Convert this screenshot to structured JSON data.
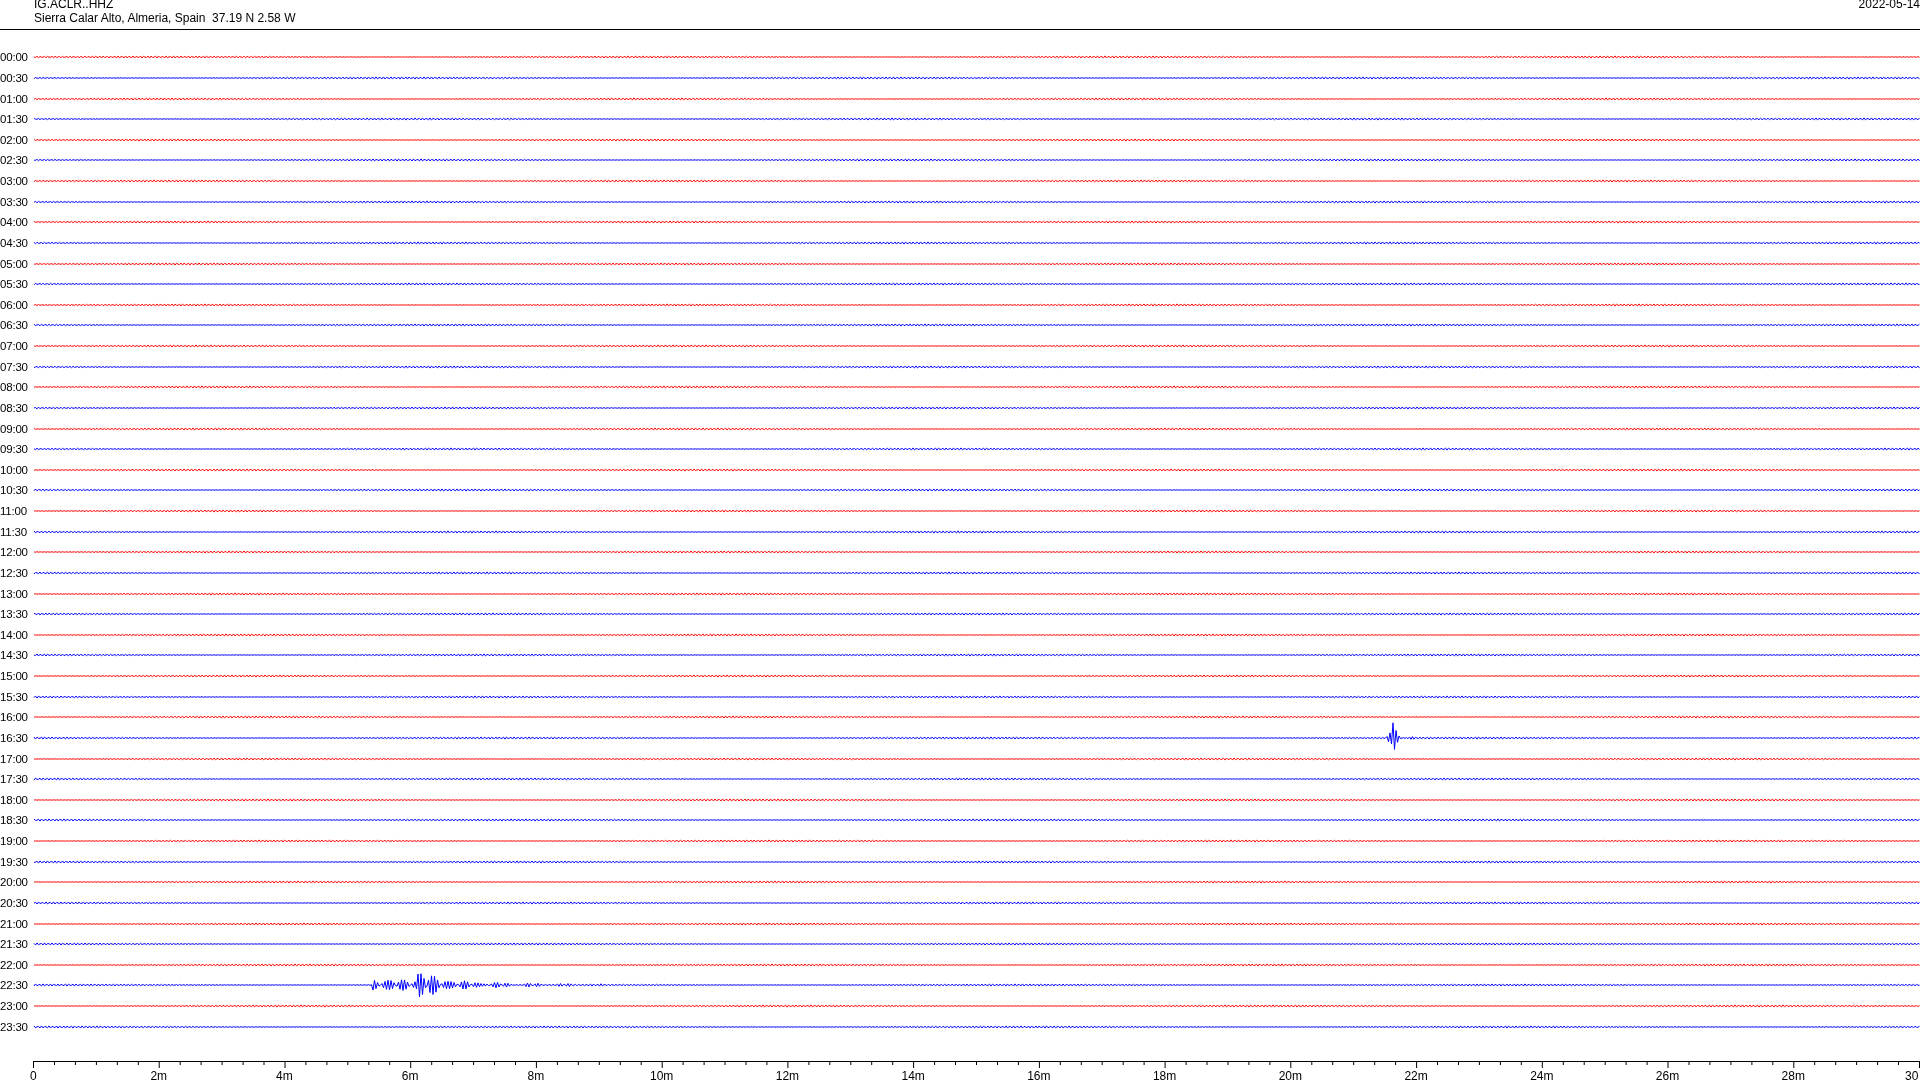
{
  "header": {
    "station": "IG.ACLR..HHZ",
    "location": "Sierra Calar Alto, Almeria, Spain  37.19 N 2.58 W",
    "date": "2022-05-14"
  },
  "rows": [
    {
      "label": "00:00",
      "color": "#ff0000",
      "kind": "quiet"
    },
    {
      "label": "00:30",
      "color": "#0000ff",
      "kind": "quiet"
    },
    {
      "label": "01:00",
      "color": "#ff0000",
      "kind": "quiet"
    },
    {
      "label": "01:30",
      "color": "#0000ff",
      "kind": "quiet"
    },
    {
      "label": "02:00",
      "color": "#ff0000",
      "kind": "quiet"
    },
    {
      "label": "02:30",
      "color": "#0000ff",
      "kind": "quiet"
    },
    {
      "label": "03:00",
      "color": "#ff0000",
      "kind": "quiet"
    },
    {
      "label": "03:30",
      "color": "#0000ff",
      "kind": "quiet"
    },
    {
      "label": "04:00",
      "color": "#ff0000",
      "kind": "quiet"
    },
    {
      "label": "04:30",
      "color": "#0000ff",
      "kind": "quiet"
    },
    {
      "label": "05:00",
      "color": "#ff0000",
      "kind": "quiet"
    },
    {
      "label": "05:30",
      "color": "#0000ff",
      "kind": "quiet"
    },
    {
      "label": "06:00",
      "color": "#ff0000",
      "kind": "quiet"
    },
    {
      "label": "06:30",
      "color": "#0000ff",
      "kind": "quiet"
    },
    {
      "label": "07:00",
      "color": "#ff0000",
      "kind": "quiet"
    },
    {
      "label": "07:30",
      "color": "#0000ff",
      "kind": "quiet"
    },
    {
      "label": "08:00",
      "color": "#ff0000",
      "kind": "quiet"
    },
    {
      "label": "08:30",
      "color": "#0000ff",
      "kind": "quiet"
    },
    {
      "label": "09:00",
      "color": "#ff0000",
      "kind": "quiet"
    },
    {
      "label": "09:30",
      "color": "#0000ff",
      "kind": "quiet"
    },
    {
      "label": "10:00",
      "color": "#ff0000",
      "kind": "quiet"
    },
    {
      "label": "10:30",
      "color": "#0000ff",
      "kind": "quiet"
    },
    {
      "label": "11:00",
      "color": "#ff0000",
      "kind": "quiet"
    },
    {
      "label": "11:30",
      "color": "#0000ff",
      "kind": "quiet"
    },
    {
      "label": "12:00",
      "color": "#ff0000",
      "kind": "quiet"
    },
    {
      "label": "12:30",
      "color": "#0000ff",
      "kind": "quiet"
    },
    {
      "label": "13:00",
      "color": "#ff0000",
      "kind": "quiet"
    },
    {
      "label": "13:30",
      "color": "#0000ff",
      "kind": "quiet"
    },
    {
      "label": "14:00",
      "color": "#ff0000",
      "kind": "quiet"
    },
    {
      "label": "14:30",
      "color": "#0000ff",
      "kind": "quiet"
    },
    {
      "label": "15:00",
      "color": "#ff0000",
      "kind": "quiet"
    },
    {
      "label": "15:30",
      "color": "#0000ff",
      "kind": "quiet"
    },
    {
      "label": "16:00",
      "color": "#ff0000",
      "kind": "quiet"
    },
    {
      "label": "16:30",
      "color": "#0000ff",
      "kind": "spike"
    },
    {
      "label": "17:00",
      "color": "#ff0000",
      "kind": "quiet"
    },
    {
      "label": "17:30",
      "color": "#0000ff",
      "kind": "quiet"
    },
    {
      "label": "18:00",
      "color": "#ff0000",
      "kind": "quiet"
    },
    {
      "label": "18:30",
      "color": "#0000ff",
      "kind": "quiet"
    },
    {
      "label": "19:00",
      "color": "#ff0000",
      "kind": "quiet"
    },
    {
      "label": "19:30",
      "color": "#0000ff",
      "kind": "quiet"
    },
    {
      "label": "20:00",
      "color": "#ff0000",
      "kind": "quiet"
    },
    {
      "label": "20:30",
      "color": "#0000ff",
      "kind": "quiet"
    },
    {
      "label": "21:00",
      "color": "#ff0000",
      "kind": "quiet"
    },
    {
      "label": "21:30",
      "color": "#0000ff",
      "kind": "quiet"
    },
    {
      "label": "22:00",
      "color": "#ff0000",
      "kind": "quiet"
    },
    {
      "label": "22:30",
      "color": "#0000ff",
      "kind": "quake"
    },
    {
      "label": "23:00",
      "color": "#ff0000",
      "kind": "quiet"
    },
    {
      "label": "23:30",
      "color": "#0000ff",
      "kind": "quiet"
    }
  ],
  "axis": {
    "ticks": [
      "0",
      "2m",
      "4m",
      "6m",
      "8m",
      "10m",
      "12m",
      "14m",
      "16m",
      "18m",
      "20m",
      "22m",
      "24m",
      "26m",
      "28m",
      "30"
    ]
  }
}
